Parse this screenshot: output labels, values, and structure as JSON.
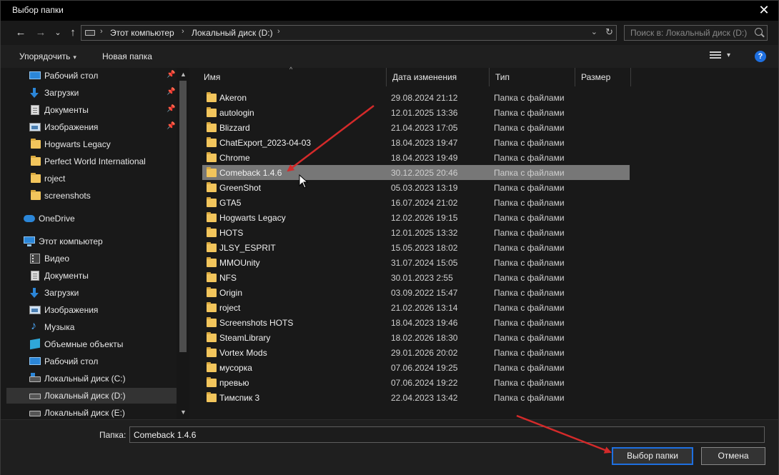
{
  "window": {
    "title": "Выбор папки",
    "close_glyph": "✕"
  },
  "nav": {
    "back": "←",
    "forward": "→",
    "recent": "⌄",
    "up": "↑"
  },
  "address": {
    "crumbs": [
      "Этот компьютер",
      "Локальный диск (D:)"
    ],
    "separator": "›",
    "dropdown": "⌄",
    "refresh": "↻"
  },
  "search": {
    "placeholder": "Поиск в: Локальный диск (D:)"
  },
  "toolbar": {
    "organize": "Упорядочить",
    "organize_caret": "▾",
    "new_folder": "Новая папка",
    "view_caret": "▾",
    "help": "?"
  },
  "sidebar": {
    "items": [
      {
        "label": "Рабочий стол",
        "icon": "desktop-icon",
        "pinned": true
      },
      {
        "label": "Загрузки",
        "icon": "download-icon",
        "pinned": true
      },
      {
        "label": "Документы",
        "icon": "documents-icon",
        "pinned": true
      },
      {
        "label": "Изображения",
        "icon": "pictures-icon",
        "pinned": true
      },
      {
        "label": "Hogwarts Legacy",
        "icon": "folder-icon",
        "pinned": false
      },
      {
        "label": "Perfect World International",
        "icon": "folder-icon",
        "pinned": false
      },
      {
        "label": "roject",
        "icon": "folder-icon",
        "pinned": false
      },
      {
        "label": "screenshots",
        "icon": "folder-icon",
        "pinned": false
      },
      {
        "label": "OneDrive",
        "icon": "onedrive-icon",
        "pinned": false
      },
      {
        "label": "Этот компьютер",
        "icon": "computer-icon",
        "pinned": false
      },
      {
        "label": "Видео",
        "icon": "video-icon",
        "pinned": false
      },
      {
        "label": "Документы",
        "icon": "documents-icon",
        "pinned": false
      },
      {
        "label": "Загрузки",
        "icon": "download-icon",
        "pinned": false
      },
      {
        "label": "Изображения",
        "icon": "pictures-icon",
        "pinned": false
      },
      {
        "label": "Музыка",
        "icon": "music-icon",
        "pinned": false
      },
      {
        "label": "Объемные объекты",
        "icon": "3d-objects-icon",
        "pinned": false
      },
      {
        "label": "Рабочий стол",
        "icon": "desktop-icon",
        "pinned": false
      },
      {
        "label": "Локальный диск (C:)",
        "icon": "system-drive-icon",
        "pinned": false
      },
      {
        "label": "Локальный диск (D:)",
        "icon": "drive-icon",
        "pinned": false,
        "selected": true
      },
      {
        "label": "Локальный диск (E:)",
        "icon": "drive-icon",
        "pinned": false
      }
    ],
    "pin_glyph": "📌",
    "scroll_up": "▲",
    "scroll_down": "▼"
  },
  "columns": {
    "name": "Имя",
    "date": "Дата изменения",
    "type": "Тип",
    "size": "Размер",
    "sort_caret": "^"
  },
  "files": [
    {
      "name": "Akeron",
      "date": "29.08.2024 21:12",
      "type": "Папка с файлами"
    },
    {
      "name": "autologin",
      "date": "12.01.2025 13:36",
      "type": "Папка с файлами"
    },
    {
      "name": "Blizzard",
      "date": "21.04.2023 17:05",
      "type": "Папка с файлами"
    },
    {
      "name": "ChatExport_2023-04-03",
      "date": "18.04.2023 19:47",
      "type": "Папка с файлами"
    },
    {
      "name": "Chrome",
      "date": "18.04.2023 19:49",
      "type": "Папка с файлами"
    },
    {
      "name": "Comeback 1.4.6",
      "date": "30.12.2025 20:46",
      "type": "Папка с файлами",
      "selected": true
    },
    {
      "name": "GreenShot",
      "date": "05.03.2023 13:19",
      "type": "Папка с файлами"
    },
    {
      "name": "GTA5",
      "date": "16.07.2024 21:02",
      "type": "Папка с файлами"
    },
    {
      "name": "Hogwarts Legacy",
      "date": "12.02.2026 19:15",
      "type": "Папка с файлами"
    },
    {
      "name": "HOTS",
      "date": "12.01.2025 13:32",
      "type": "Папка с файлами"
    },
    {
      "name": "JLSY_ESPRIT",
      "date": "15.05.2023 18:02",
      "type": "Папка с файлами"
    },
    {
      "name": "MMOUnity",
      "date": "31.07.2024 15:05",
      "type": "Папка с файлами"
    },
    {
      "name": "NFS",
      "date": "30.01.2023 2:55",
      "type": "Папка с файлами"
    },
    {
      "name": "Origin",
      "date": "03.09.2022 15:47",
      "type": "Папка с файлами"
    },
    {
      "name": "roject",
      "date": "21.02.2026 13:14",
      "type": "Папка с файлами"
    },
    {
      "name": "Screenshots HOTS",
      "date": "18.04.2023 19:46",
      "type": "Папка с файлами"
    },
    {
      "name": "SteamLibrary",
      "date": "18.02.2026 18:30",
      "type": "Папка с файлами"
    },
    {
      "name": "Vortex Mods",
      "date": "29.01.2026 20:02",
      "type": "Папка с файлами"
    },
    {
      "name": "мусорка",
      "date": "07.06.2024 19:25",
      "type": "Папка с файлами"
    },
    {
      "name": "превью",
      "date": "07.06.2024 19:22",
      "type": "Папка с файлами"
    },
    {
      "name": "Тимспик 3",
      "date": "22.04.2023 13:42",
      "type": "Папка с файлами"
    }
  ],
  "footer": {
    "folder_label": "Папка:",
    "folder_value": "Comeback 1.4.6",
    "select_button": "Выбор папки",
    "cancel_button": "Отмена"
  },
  "colors": {
    "accent": "#1e6fe0",
    "annotation_arrow": "#d42a2a",
    "folder": "#f2c55c",
    "selection": "#777777"
  }
}
